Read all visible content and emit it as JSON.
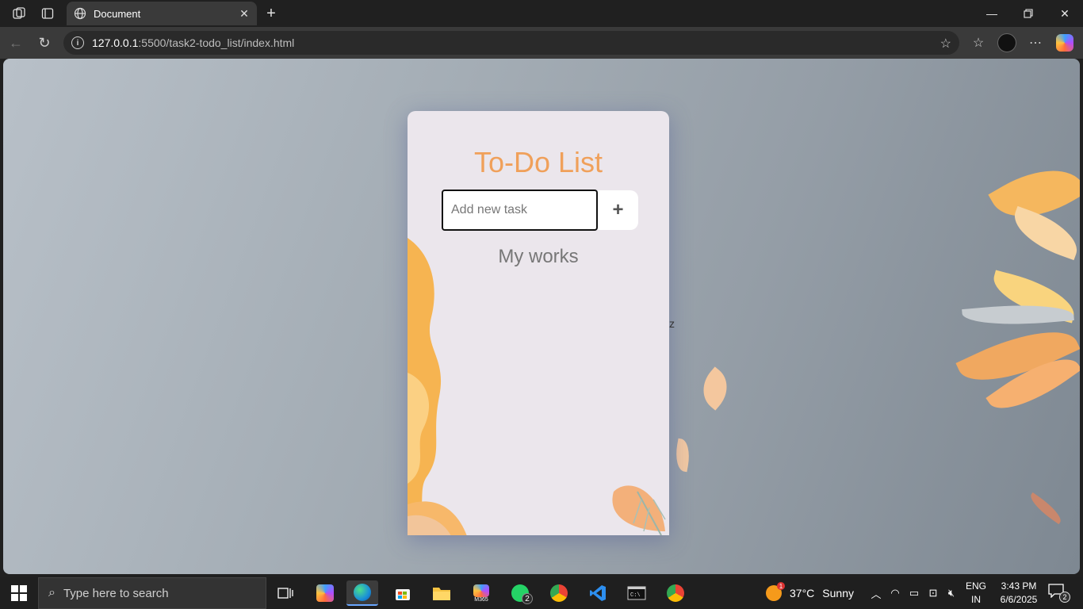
{
  "browser": {
    "tab_title": "Document",
    "url_host": "127.0.0.1",
    "url_path": ":5500/task2-todo_list/index.html"
  },
  "page": {
    "title": "To-Do List",
    "input_placeholder": "Add new task",
    "input_value": "",
    "add_button_label": "+",
    "section_title": "My works",
    "stray_text": "z"
  },
  "taskbar": {
    "search_placeholder": "Type here to search",
    "whatsapp_badge": "2",
    "m365_label": "M365",
    "weather_badge": "1",
    "weather_temp": "37°C",
    "weather_desc": "Sunny",
    "lang_line1": "ENG",
    "lang_line2": "IN",
    "time": "3:43 PM",
    "date": "6/6/2025",
    "notifications_count": "2"
  },
  "colors": {
    "title_orange": "#f0a05a",
    "card_bg": "#ebe6ec",
    "page_bg": "#a5aeb6"
  }
}
